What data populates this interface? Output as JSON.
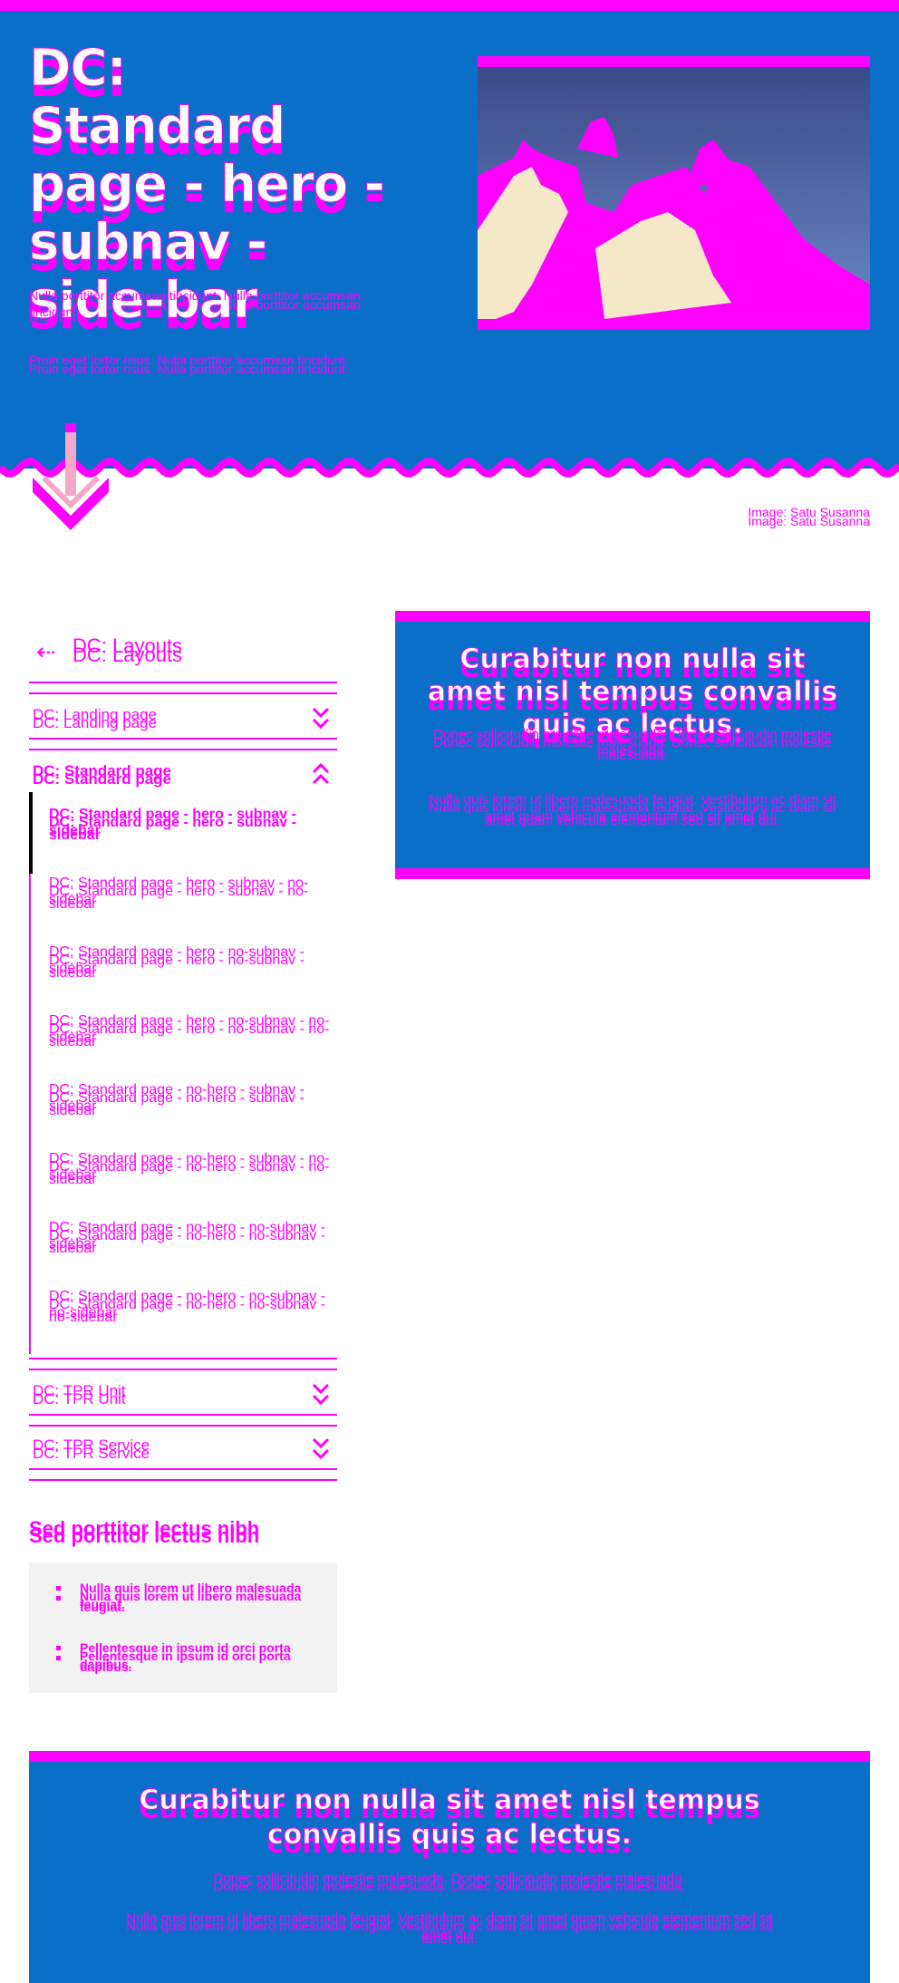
{
  "hero": {
    "title": "DC: Standard page - hero - subnav - side-bar",
    "p1": "Nulla porttitor accumsan tincidunt. Nulla porttitor accumsan tincidunt.",
    "p2": "Proin eget tortor risus. Nulla porttitor accumsan tincidunt.",
    "image_caption": "Image: Satu Susanna",
    "scroll_icon": "arrow-down-icon"
  },
  "sidebar": {
    "back_label": "DC: Layouts",
    "back_icon": "arrow-left-icon",
    "sections": [
      {
        "label": "DC: Landing page",
        "expanded": false
      },
      {
        "label": "DC: Standard page",
        "expanded": true
      },
      {
        "label": "DC: TPR Unit",
        "expanded": false
      },
      {
        "label": "DC: TPR Service",
        "expanded": false
      }
    ],
    "sub_items": [
      {
        "label": "DC: Standard page - hero - subnav - sidebar",
        "active": true
      },
      {
        "label": "DC: Standard page - hero - subnav - no-sidebar",
        "active": false
      },
      {
        "label": "DC: Standard page - hero - no-subnav - sidebar",
        "active": false
      },
      {
        "label": "DC: Standard page - hero - no-subnav - no-sidebar",
        "active": false
      },
      {
        "label": "DC: Standard page - no-hero - subnav - sidebar",
        "active": false
      },
      {
        "label": "DC: Standard page - no-hero - subnav - no-sidebar",
        "active": false
      },
      {
        "label": "DC: Standard page - no-hero - no-subnav - sidebar",
        "active": false
      },
      {
        "label": "DC: Standard page - no-hero - no-subnav - no-sidebar",
        "active": false
      }
    ]
  },
  "side_section": {
    "title": "Sed porttitor lectus nibh",
    "bullets": [
      "Nulla quis lorem ut libero malesuada feugiat.",
      "Pellentesque in ipsum id orci porta dapibus."
    ]
  },
  "callout": {
    "title": "Curabitur non nulla sit amet nisl tempus convallis quis ac lectus.",
    "p1": "Donec sollicitudin molestie malesuada. Donec sollicitudin molestie malesuada.",
    "p2": "Nulla quis lorem ut libero malesuada feugiat. Vestibulum ac diam sit amet quam vehicula elementum sed sit amet dui."
  },
  "wide_callout": {
    "title": "Curabitur non nulla sit amet nisl tempus convallis quis ac lectus.",
    "p1": "Donec sollicitudin molestie malesuada. Donec sollicitudin molestie malesuada.",
    "p2": "Nulla quis lorem ut libero malesuada feugiat. Vestibulum ac diam sit amet quam vehicula elementum sed sit amet dui."
  },
  "colors": {
    "accent": "#ff00ff",
    "brand_blue": "#0a6fc9",
    "box_grey": "#f2f2f2"
  }
}
